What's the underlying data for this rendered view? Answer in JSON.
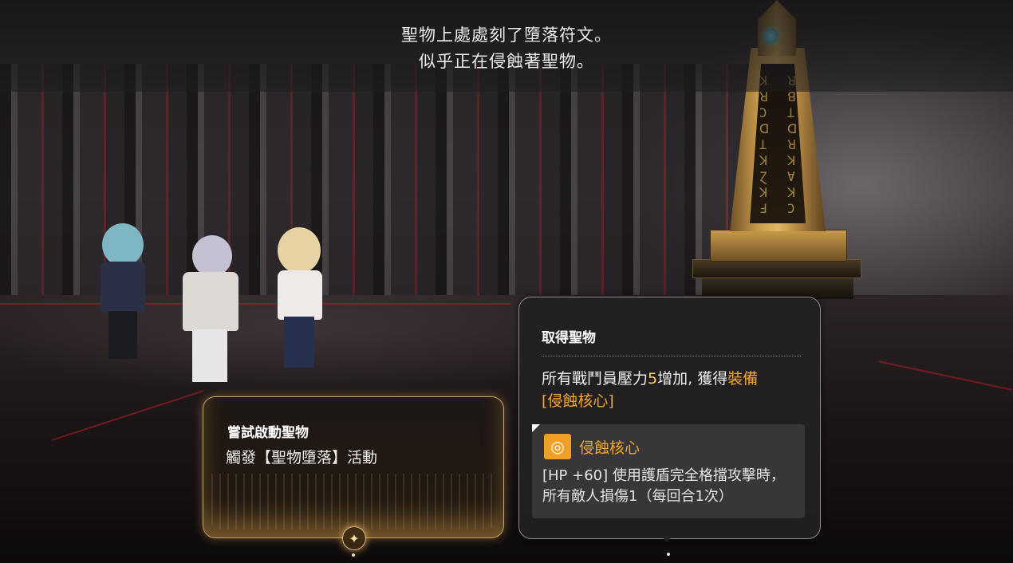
{
  "narration": {
    "line1": "聖物上處處刻了墮落符文。",
    "line2": "似乎正在侵蝕著聖物。"
  },
  "choices": [
    {
      "title": "嘗試啟動聖物",
      "description": "觸發【聖物墮落】活動",
      "icon": "star-sparkle-icon"
    },
    {
      "title": "取得聖物",
      "description_prefix": "所有戰鬥員壓力",
      "description_number": "5",
      "description_middle": "增加, 獲得",
      "description_equip": "裝備",
      "description_item": "[侵蝕核心]",
      "reward": {
        "name": "侵蝕核心",
        "icon": "ring-icon",
        "effect": "[HP +60] 使用護盾完全格擋攻擊時，所有敵人損傷1（每回合1次）"
      }
    }
  ],
  "colors": {
    "gold_border": "#c7a46b",
    "highlight_orange": "#f2a72f",
    "highlight_yellow": "#ffd268",
    "item_icon_bg": "#f0a026"
  }
}
